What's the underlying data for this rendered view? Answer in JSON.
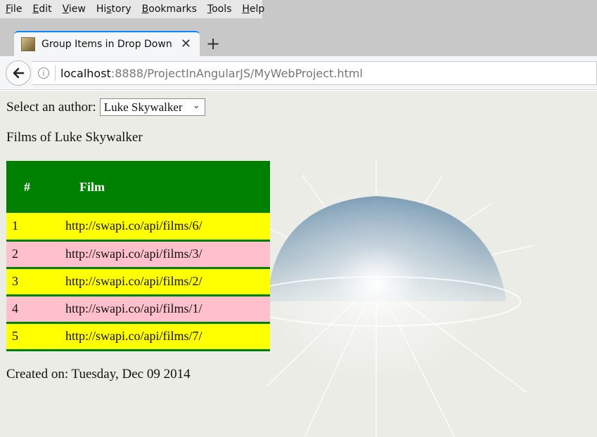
{
  "menu": [
    {
      "label": "File",
      "ul": "F",
      "rest": "ile"
    },
    {
      "label": "Edit",
      "ul": "E",
      "rest": "dit"
    },
    {
      "label": "View",
      "ul": "V",
      "rest": "iew"
    },
    {
      "label": "History",
      "pre": "Hi",
      "ul": "s",
      "rest": "tory"
    },
    {
      "label": "Bookmarks",
      "ul": "B",
      "rest": "ookmarks"
    },
    {
      "label": "Tools",
      "ul": "T",
      "rest": "ools"
    },
    {
      "label": "Help",
      "ul": "H",
      "rest": "elp"
    }
  ],
  "tab": {
    "title": "Group Items in Drop Down",
    "close": "✕"
  },
  "newtab": "+",
  "url": {
    "host": "localhost",
    "rest": ":8888/ProjectInAngularJS/MyWebProject.html"
  },
  "page": {
    "select_label": "Select an author:",
    "selected_author": "Luke Skywalker",
    "films_heading": "Films of Luke Skywalker",
    "table_headers": [
      "#",
      "Film"
    ],
    "rows": [
      {
        "num": "1",
        "film": "http://swapi.co/api/films/6/"
      },
      {
        "num": "2",
        "film": "http://swapi.co/api/films/3/"
      },
      {
        "num": "3",
        "film": "http://swapi.co/api/films/2/"
      },
      {
        "num": "4",
        "film": "http://swapi.co/api/films/1/"
      },
      {
        "num": "5",
        "film": "http://swapi.co/api/films/7/"
      }
    ],
    "created": "Created on: Tuesday, Dec 09 2014"
  },
  "colors": {
    "header_green": "#008000",
    "row_yellow": "#ffff00",
    "row_pink": "#ffc0cb"
  }
}
